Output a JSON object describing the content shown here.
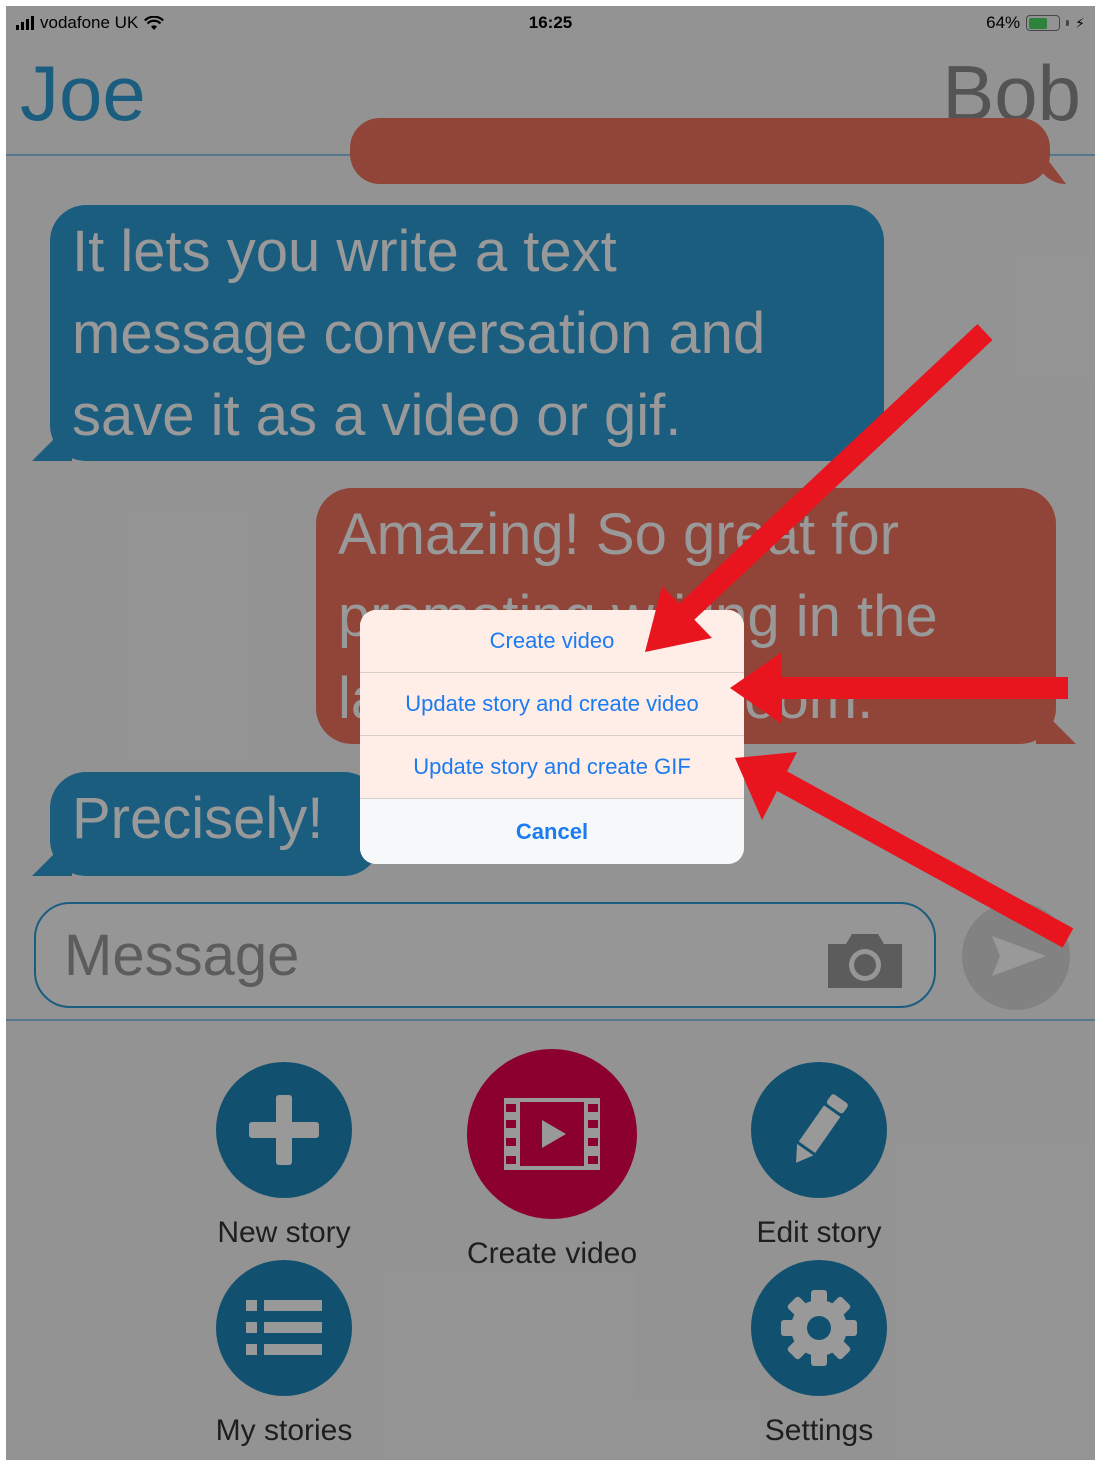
{
  "status_bar": {
    "carrier": "vodafone UK",
    "time": "16:25",
    "battery": "64%",
    "battery_level": 0.64
  },
  "header": {
    "left_name": "Joe",
    "right_name": "Bob"
  },
  "messages": [
    {
      "side": "left",
      "text_lines": [
        "It lets you write a text",
        "message conversation and",
        "save it as a video or gif."
      ]
    },
    {
      "side": "right",
      "text_lines": [
        "Amazing! So great for",
        "promoting writing in the",
        "language classroom."
      ]
    },
    {
      "side": "left",
      "text_lines": [
        "Precisely!"
      ]
    }
  ],
  "composer": {
    "placeholder": "Message"
  },
  "toolbar": {
    "new_story": "New story",
    "create_video": "Create video",
    "edit_story": "Edit story",
    "my_stories": "My stories",
    "settings": "Settings"
  },
  "action_sheet": {
    "options": [
      "Create video",
      "Update story and create video",
      "Update story and create GIF"
    ],
    "cancel": "Cancel"
  },
  "annotations": {
    "arrow_color": "#e8141e"
  },
  "colors": {
    "joe_blue": "#2e9bd4",
    "bob_coral": "#f1735e",
    "create_video_magenta": "#e8004f",
    "ios_link_blue": "#1b7bf0"
  }
}
